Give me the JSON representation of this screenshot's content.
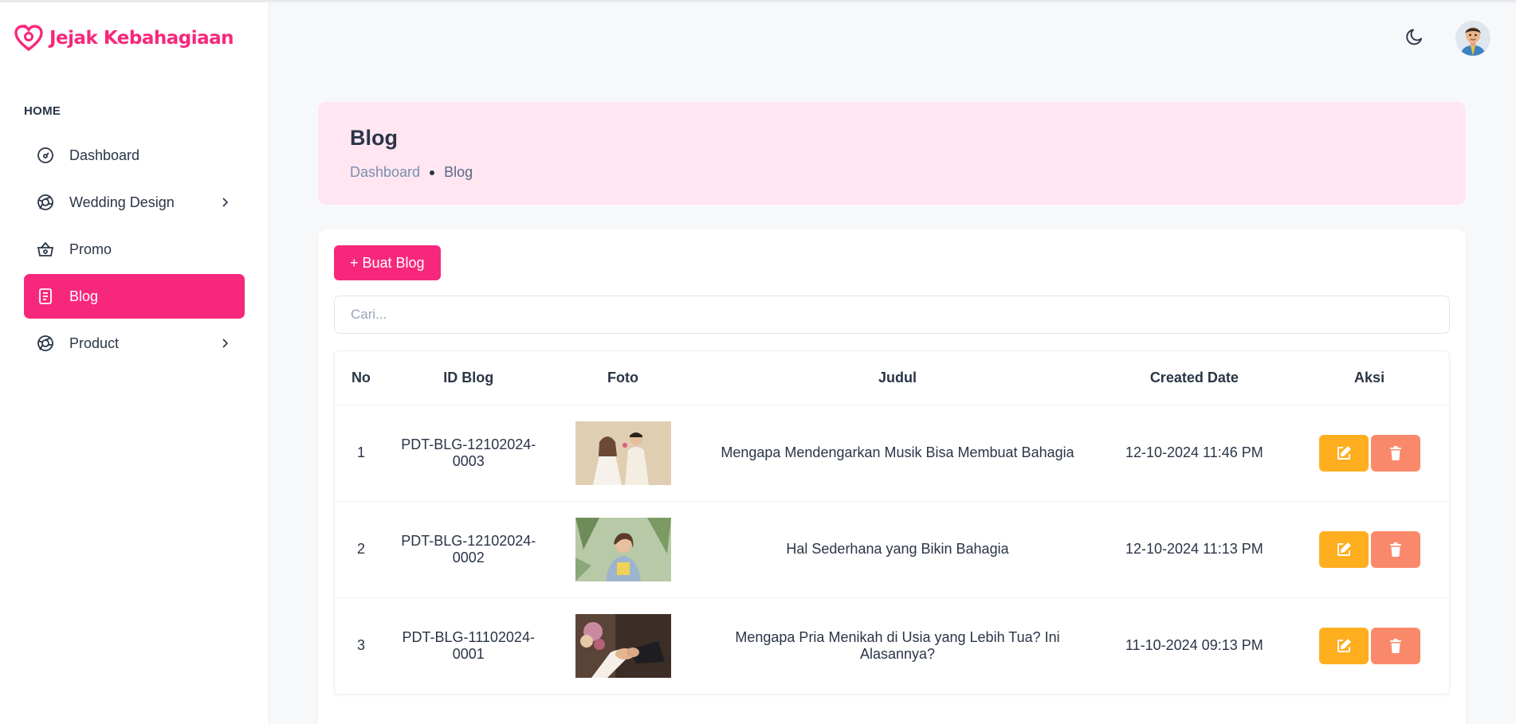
{
  "app": {
    "logo_text": "Jejak Kebahagiaan"
  },
  "sidebar": {
    "section": "HOME",
    "items": [
      {
        "label": "Dashboard",
        "icon": "gauge-icon",
        "active": false,
        "has_chevron": false
      },
      {
        "label": "Wedding Design",
        "icon": "aperture-icon",
        "active": false,
        "has_chevron": true
      },
      {
        "label": "Promo",
        "icon": "basket-icon",
        "active": false,
        "has_chevron": false
      },
      {
        "label": "Blog",
        "icon": "document-icon",
        "active": true,
        "has_chevron": false
      },
      {
        "label": "Product",
        "icon": "aperture-icon",
        "active": false,
        "has_chevron": true
      }
    ]
  },
  "header": {
    "theme_toggle_icon": "moon-icon",
    "avatar_icon": "user-avatar"
  },
  "banner": {
    "title": "Blog",
    "breadcrumb": {
      "home": "Dashboard",
      "current": "Blog"
    }
  },
  "toolbar": {
    "create_label": "+ Buat Blog",
    "search_placeholder": "Cari..."
  },
  "table": {
    "columns": [
      "No",
      "ID Blog",
      "Foto",
      "Judul",
      "Created Date",
      "Aksi"
    ],
    "rows": [
      {
        "no": "1",
        "id": "PDT-BLG-12102024-0003",
        "photo": "couple-portrait-photo",
        "title": "Mengapa Mendengarkan Musik Bisa Membuat Bahagia",
        "date": "12-10-2024 11:46 PM"
      },
      {
        "no": "2",
        "id": "PDT-BLG-12102024-0002",
        "photo": "woman-smiling-photo",
        "title": "Hal Sederhana yang Bikin Bahagia",
        "date": "12-10-2024 11:13 PM"
      },
      {
        "no": "3",
        "id": "PDT-BLG-11102024-0001",
        "photo": "wedding-hands-photo",
        "title": "Mengapa Pria Menikah di Usia yang Lebih Tua? Ini Alasannya?",
        "date": "11-10-2024 09:13 PM"
      }
    ]
  },
  "colors": {
    "brand": "#f7287b",
    "banner_bg": "#ffe6f1",
    "edit": "#ffae1f",
    "delete": "#fa896b"
  }
}
